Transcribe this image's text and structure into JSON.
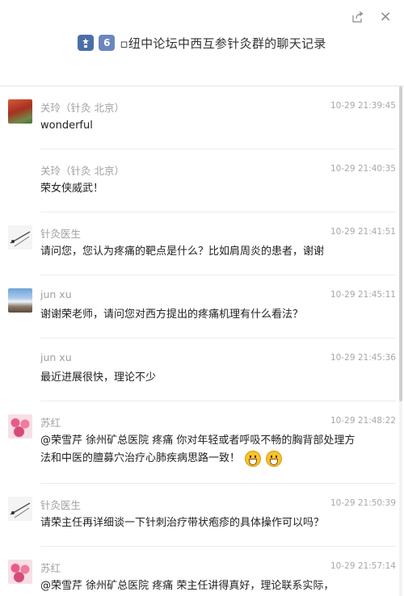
{
  "window": {
    "share_icon": "share-icon",
    "close_icon": "close-icon",
    "close_glyph": "×"
  },
  "header": {
    "icon1": "statue-icon",
    "icon2_glyph": "6",
    "title": "▫纽中论坛中西互参针灸群的聊天记录"
  },
  "messages": [
    {
      "sender": "关玲（针灸 北京）",
      "time": "10-29 21:39:45",
      "text": "wonderful",
      "avatar": "red-leaves-avatar"
    },
    {
      "sender": "关玲（针灸 北京）",
      "time": "10-29 21:40:35",
      "text": "荣女侠威武！",
      "avatar": ""
    },
    {
      "sender": "针灸医生",
      "time": "10-29 21:41:51",
      "text": "请问您，您认为疼痛的靶点是什么？比如肩周炎的患者，谢谢",
      "avatar": "needle-avatar"
    },
    {
      "sender": "jun xu",
      "time": "10-29 21:45:11",
      "text": "谢谢荣老师，请问您对西方提出的疼痛机理有什么看法？",
      "avatar": "mountain-avatar"
    },
    {
      "sender": "jun xu",
      "time": "10-29 21:45:36",
      "text": "最近进展很快，理论不少",
      "avatar": ""
    },
    {
      "sender": "苏红",
      "time": "10-29 21:48:22",
      "text": "@荣雪芹 徐州矿总医院 疼痛 你对年轻或者呼吸不畅的胸背部处理方法和中医的膻募穴治疗心肺疾病思路一致！",
      "avatar": "flower-avatar",
      "emojis": [
        "grin-emoji",
        "grin-emoji"
      ]
    },
    {
      "sender": "针灸医生",
      "time": "10-29 21:50:39",
      "text": "请荣主任再详细谈一下针刺治疗带状疱疹的具体操作可以吗？",
      "avatar": "needle-avatar"
    },
    {
      "sender": "苏红",
      "time": "10-29 21:57:14",
      "text": "@荣雪芹 徐州矿总医院 疼痛 荣主任讲得真好，理论联系实际，",
      "avatar": "flower-avatar"
    }
  ]
}
